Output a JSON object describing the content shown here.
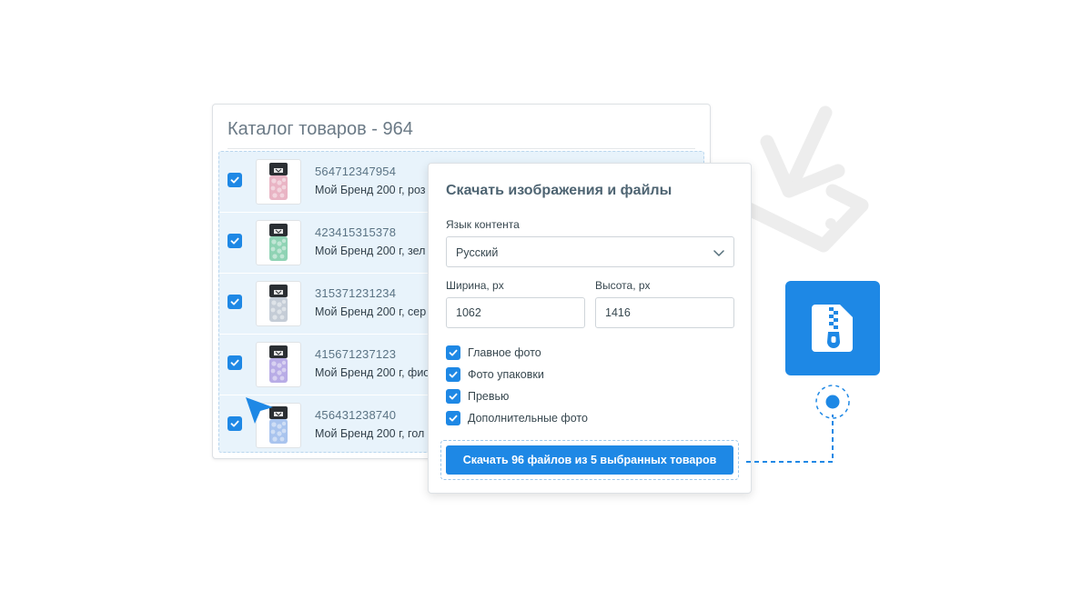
{
  "catalog": {
    "title": "Каталог товаров - 964",
    "products": [
      {
        "code": "564712347954",
        "name": "Мой Бренд 200 г, роз",
        "checked": true,
        "candy_color": "#e9b4c4"
      },
      {
        "code": "423415315378",
        "name": "Мой Бренд 200 г, зел",
        "checked": true,
        "candy_color": "#8fd3b4"
      },
      {
        "code": "315371231234",
        "name": "Мой Бренд 200 г, сер",
        "checked": true,
        "candy_color": "#c4ccd6"
      },
      {
        "code": "415671237123",
        "name": "Мой Бренд 200 г, фио",
        "checked": true,
        "candy_color": "#b8ace6"
      },
      {
        "code": "456431238740",
        "name": "Мой Бренд 200 г, гол",
        "checked": true,
        "candy_color": "#a9c4ee"
      }
    ]
  },
  "download_dialog": {
    "title": "Скачать изображения и файлы",
    "language_label": "Язык контента",
    "language_value": "Русский",
    "width_label": "Ширина, px",
    "width_value": "1062",
    "height_label": "Высота, px",
    "height_value": "1416",
    "options": [
      {
        "label": "Главное фото",
        "checked": true
      },
      {
        "label": "Фото упаковки",
        "checked": true
      },
      {
        "label": "Превью",
        "checked": true
      },
      {
        "label": "Дополнительные фото",
        "checked": true
      }
    ],
    "button_label": "Скачать 96 файлов из 5 выбранных товаров"
  },
  "icons": {
    "background": "download-arrow-icon",
    "file": "zip-file-icon",
    "cursor": "cursor-arrow-icon"
  },
  "colors": {
    "accent": "#1e88e5",
    "selection_bg": "#e8f3fb",
    "text_muted": "#6b7a86"
  }
}
